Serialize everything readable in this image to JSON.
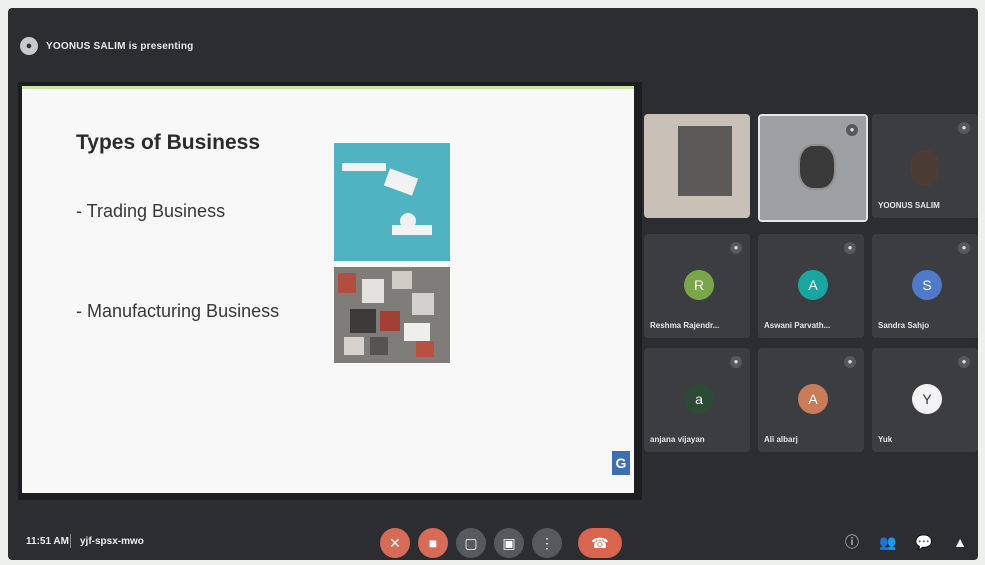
{
  "header": {
    "presenting_text": "YOONUS SALIM is presenting",
    "avatar_icon": "person-avatar-icon"
  },
  "slide": {
    "title": "Types of Business",
    "bullets": [
      "- Trading Business",
      "- Manufacturing Business"
    ],
    "badge": "G"
  },
  "participants": [
    {
      "name": "",
      "type": "video"
    },
    {
      "name": "",
      "type": "video"
    },
    {
      "name": "YOONUS SALIM",
      "type": "video"
    },
    {
      "name": "Reshma Rajendr...",
      "letter": "R",
      "color": "#7aa64a",
      "type": "avatar"
    },
    {
      "name": "Aswani Parvath...",
      "letter": "A",
      "color": "#1aa6a0",
      "type": "avatar"
    },
    {
      "name": "Sandra Sahjo",
      "letter": "S",
      "color": "#4f79c9",
      "type": "avatar"
    },
    {
      "name": "anjana vijayan",
      "letter": "a",
      "color": "#2b4b36",
      "type": "avatar"
    },
    {
      "name": "Ali albarj",
      "letter": "A",
      "color": "#c97b5a",
      "type": "avatar"
    },
    {
      "name": "Yuk",
      "letter": "Y",
      "color": "#f3f3f3",
      "type": "avatar"
    }
  ],
  "bottom_bar": {
    "time": "11:51 AM",
    "meeting_code": "yjf-spsx-mwo",
    "controls": {
      "mic_off_icon": "mic-off-icon",
      "camera_off_icon": "camera-off-icon",
      "captions_icon": "captions-icon",
      "present_icon": "present-icon",
      "more_icon": "more-options-icon",
      "end_call_icon": "end-call-icon"
    },
    "right_icons": [
      "info-icon",
      "people-icon",
      "chat-icon",
      "activities-icon"
    ]
  }
}
